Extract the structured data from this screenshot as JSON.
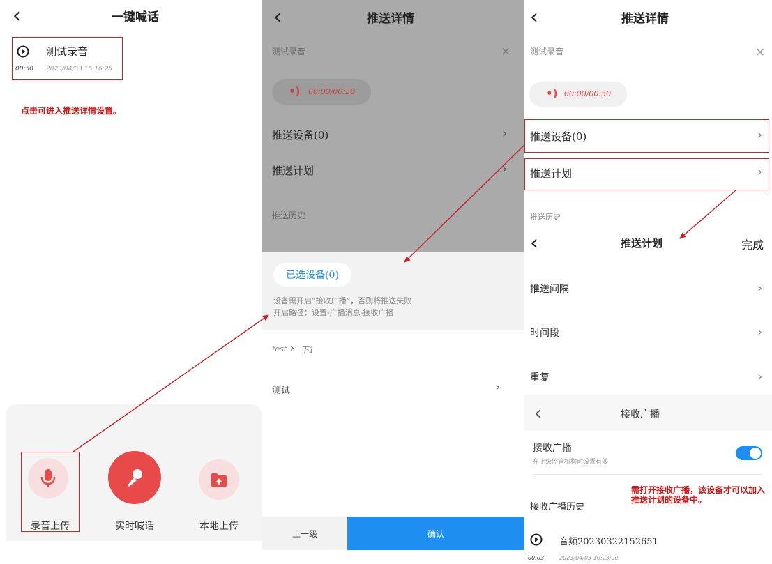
{
  "panel1": {
    "title": "一键喊话",
    "recording": {
      "name": "测试录音",
      "duration": "00:50",
      "datetime": "2023/04/03 16:16:25"
    },
    "hint": "点击可进入推送详情设置。",
    "actions": [
      {
        "label": "录音上传",
        "icon": "mic-icon"
      },
      {
        "label": "实时喊话",
        "icon": "handheld-mic-icon"
      },
      {
        "label": "本地上传",
        "icon": "folder-upload-icon"
      }
    ]
  },
  "panel2": {
    "title": "推送详情",
    "recording_name": "测试录音",
    "close_glyph": "×",
    "playback_time": "00:00/00:50",
    "push_devices_label": "推送设备(0)",
    "push_plan_label": "推送计划",
    "push_history_label": "推送历史",
    "selected_devices_label": "已选设备(0)",
    "notice_line1": "设备需开启“接收广播”，否则将推送失败",
    "notice_line2": "开启路径：设置-广播消息-接收广播",
    "breadcrumb_root": "test",
    "breadcrumb_sep": "›",
    "breadcrumb_current": "下1",
    "device_item": "测试",
    "prev_button": "上一级",
    "confirm_button": "确认",
    "colors": {
      "confirm_bg": "#1e8ff0",
      "overlay": "#aaaaaa"
    }
  },
  "panel3": {
    "title": "推送详情",
    "recording_name": "测试录音",
    "close_glyph": "×",
    "playback_time": "00:00/00:50",
    "push_devices_label": "推送设备(0)",
    "push_plan_label": "推送计划",
    "push_history_label": "推送历史",
    "plan": {
      "title": "推送计划",
      "done": "完成",
      "rows": [
        "推送间隔",
        "时间段",
        "重复"
      ]
    },
    "receive": {
      "title": "接收广播",
      "toggle_label": "接收广播",
      "toggle_sub": "在上级监管机构时设置有效",
      "toggle_on": true,
      "note_line1": "需打开接收广播，该设备才可以加入",
      "note_line2": "推送计划的设备中。",
      "history_label": "接收广播历史",
      "item_name": "音频20230322152651",
      "item_duration": "00:03",
      "item_datetime": "2023/04/03 10:23:00"
    }
  },
  "accent": {
    "red": "#e84a4a",
    "blue": "#1e8ff0",
    "annot": "#c22222"
  }
}
